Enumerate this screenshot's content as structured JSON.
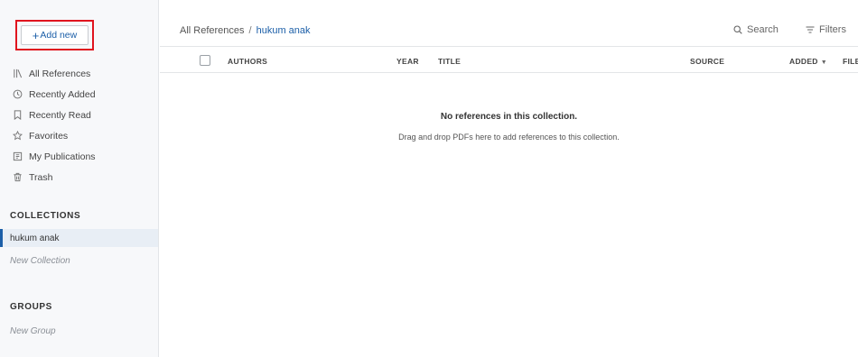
{
  "sidebar": {
    "add_new_label": "Add new",
    "nav": [
      {
        "label": "All References",
        "icon": "library-icon"
      },
      {
        "label": "Recently Added",
        "icon": "clock-icon"
      },
      {
        "label": "Recently Read",
        "icon": "bookmark-icon"
      },
      {
        "label": "Favorites",
        "icon": "star-icon"
      },
      {
        "label": "My Publications",
        "icon": "publications-icon"
      },
      {
        "label": "Trash",
        "icon": "trash-icon"
      }
    ],
    "collections_title": "COLLECTIONS",
    "collections": [
      {
        "label": "hukum anak",
        "selected": true
      }
    ],
    "new_collection_label": "New Collection",
    "groups_title": "GROUPS",
    "new_group_label": "New Group"
  },
  "header": {
    "breadcrumb_root": "All References",
    "breadcrumb_separator": "/",
    "breadcrumb_current": "hukum anak",
    "search_label": "Search",
    "filters_label": "Filters"
  },
  "table": {
    "columns": {
      "authors": "AUTHORS",
      "year": "YEAR",
      "title": "TITLE",
      "source": "SOURCE",
      "added": "ADDED",
      "file": "FILE"
    }
  },
  "empty_state": {
    "title": "No references in this collection.",
    "subtitle": "Drag and drop PDFs here to add references to this collection."
  },
  "colors": {
    "accent": "#1c5fa8",
    "highlight_box": "#e0141e",
    "sidebar_bg": "#f7f8fa",
    "selected_bg": "#e8eef5"
  }
}
